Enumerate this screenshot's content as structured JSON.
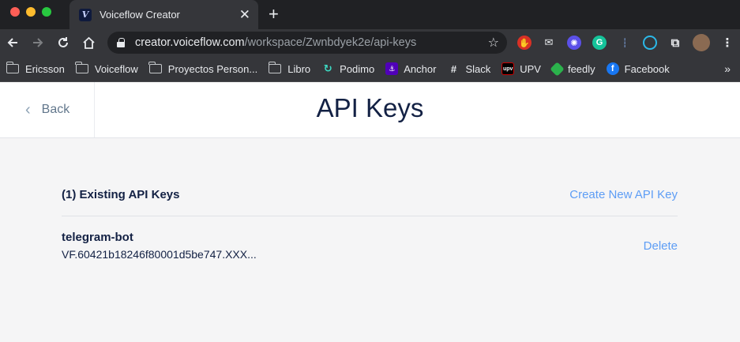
{
  "browser": {
    "tab_title": "Voiceflow Creator",
    "tab_favicon": "V",
    "new_tab_symbol": "+",
    "close_symbol": "✕",
    "url_host": "creator.voiceflow.com",
    "url_path": "/workspace/Zwnbdyek2e/api-keys",
    "bookmarks": [
      {
        "label": "Ericsson",
        "icon": "folder-icon"
      },
      {
        "label": "Voiceflow",
        "icon": "folder-icon"
      },
      {
        "label": "Proyectos Person...",
        "icon": "folder-icon"
      },
      {
        "label": "Libro",
        "icon": "folder-icon"
      },
      {
        "label": "Podimo",
        "icon": "podimo-icon"
      },
      {
        "label": "Anchor",
        "icon": "anchor-icon"
      },
      {
        "label": "Slack",
        "icon": "slack-icon"
      },
      {
        "label": "UPV",
        "icon": "upv-icon"
      },
      {
        "label": "feedly",
        "icon": "feedly-icon"
      },
      {
        "label": "Facebook",
        "icon": "facebook-icon"
      }
    ],
    "more_bookmarks": "»"
  },
  "header": {
    "back_label": "Back",
    "title": "API Keys"
  },
  "keys_section": {
    "title": "(1) Existing API Keys",
    "create_label": "Create New API Key",
    "keys": [
      {
        "name": "telegram-bot",
        "value": "VF.60421b18246f80001d5be747.XXX...",
        "delete_label": "Delete"
      }
    ]
  },
  "colors": {
    "accent_link": "#5d9df5",
    "title_text": "#132144",
    "page_bg": "#f5f5f6"
  }
}
